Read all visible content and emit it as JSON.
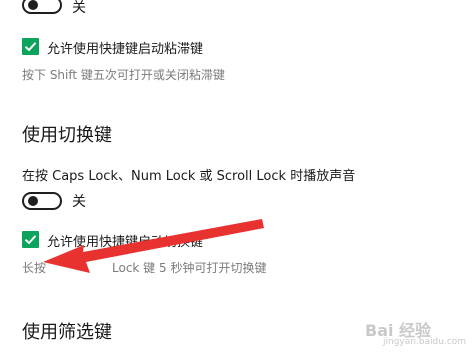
{
  "sticky_keys": {
    "toggle_state": "关",
    "shortcut_checkbox_label": "允许使用快捷键启动粘滞键",
    "shortcut_desc": "按下 Shift 键五次可打开或关闭粘滞键"
  },
  "toggle_keys": {
    "heading": "使用切换键",
    "sound_label": "在按 Caps Lock、Num Lock 或 Scroll Lock 时播放声音",
    "toggle_state": "关",
    "shortcut_checkbox_label": "允许使用快捷键启动切换键",
    "shortcut_desc_visible": "长按",
    "shortcut_desc_rest": "Lock 键 5 秒钟可打开切换键"
  },
  "filter_keys": {
    "heading": "使用筛选键"
  },
  "watermark": {
    "text": "Bai 经验",
    "sub": "jingyan.baidu.com"
  },
  "colors": {
    "checkbox": "#0ca35c",
    "arrow": "#e8322f"
  },
  "icons": {
    "checkbox_mark": "checkmark-icon",
    "annotation": "red-arrow-icon"
  }
}
